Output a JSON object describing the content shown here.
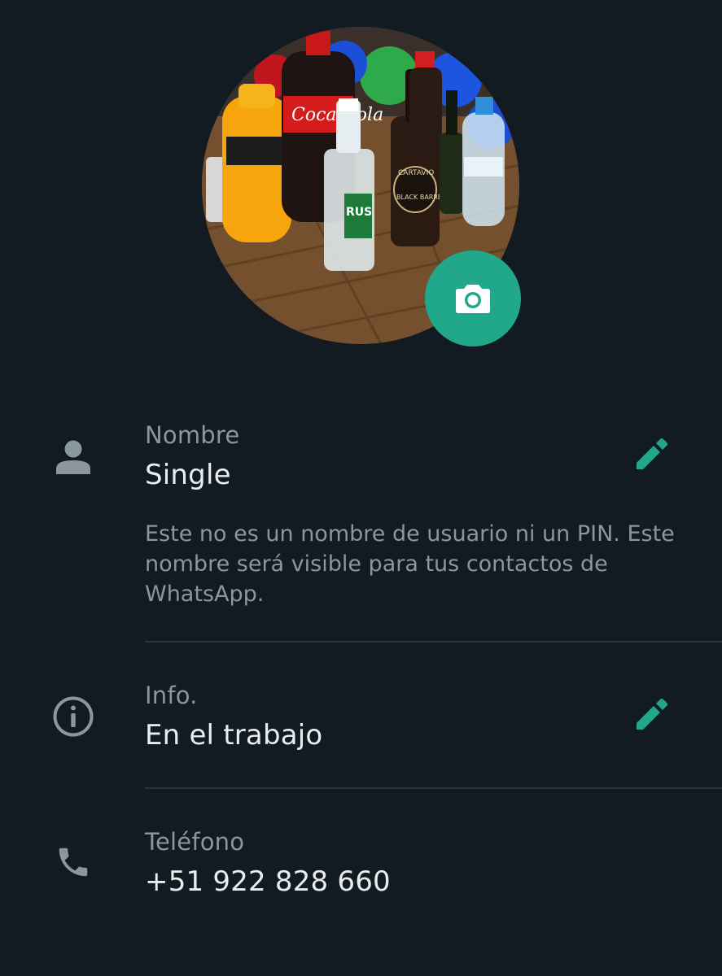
{
  "profile": {
    "photo_alt": "Foto de perfil",
    "colors": {
      "accent": "#21a88a",
      "background": "#111b21"
    }
  },
  "name": {
    "label": "Nombre",
    "value": "Single",
    "helper": "Este no es un nombre de usuario ni un PIN. Este nombre será visible para tus contactos de WhatsApp."
  },
  "about": {
    "label": "Info.",
    "value": "En el trabajo"
  },
  "phone": {
    "label": "Teléfono",
    "value": "+51 922 828 660"
  },
  "icons": {
    "camera": "camera-icon",
    "person": "person-icon",
    "info": "info-icon",
    "phone": "phone-icon",
    "edit": "pencil-icon"
  }
}
